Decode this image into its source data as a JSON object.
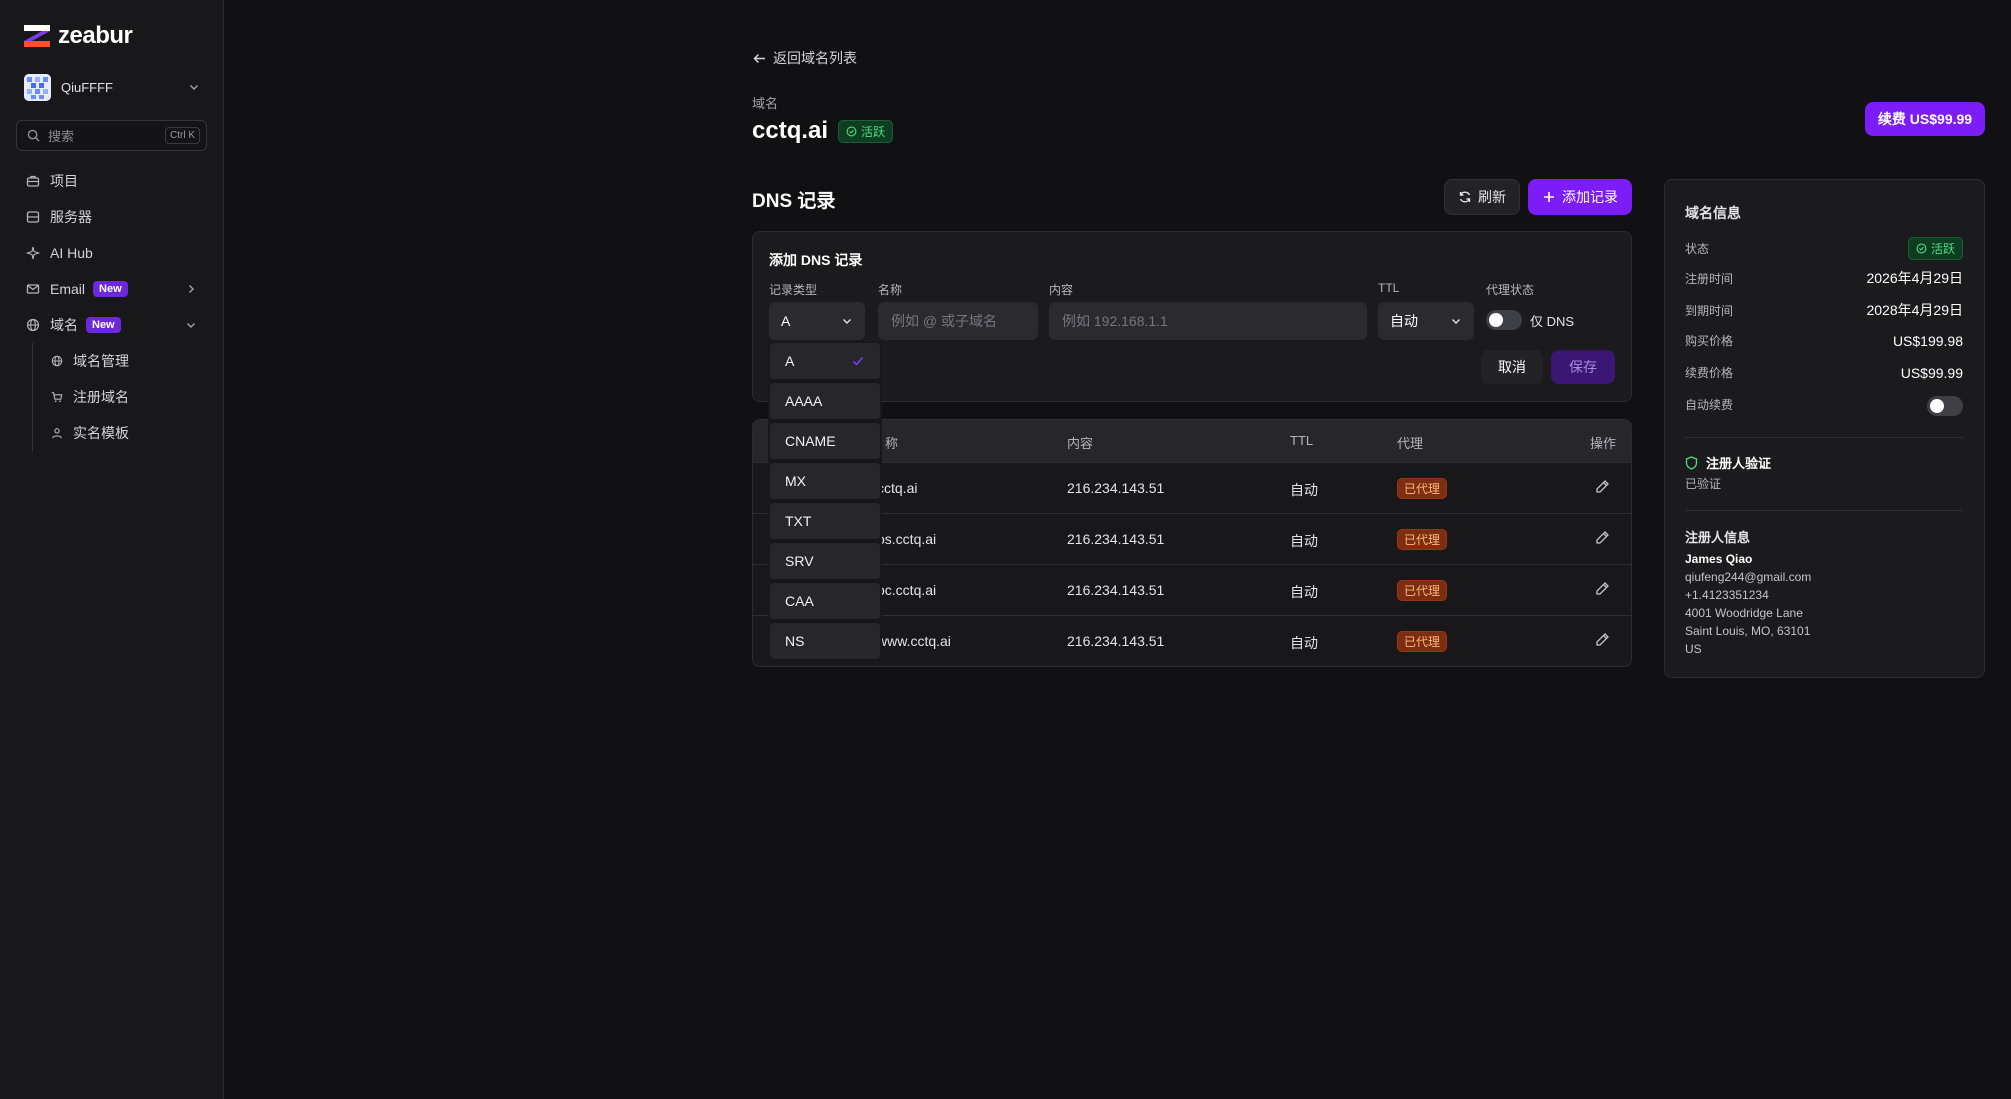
{
  "brand": {
    "name": "zeabur"
  },
  "sidebar": {
    "team": "QiuFFFF",
    "search": {
      "placeholder": "搜索",
      "shortcut": "Ctrl K"
    },
    "items": [
      {
        "label": "项目",
        "icon": "briefcase-icon"
      },
      {
        "label": "服务器",
        "icon": "server-icon"
      },
      {
        "label": "AI Hub",
        "icon": "sparkle-icon"
      },
      {
        "label": "Email",
        "icon": "mail-icon",
        "badge": "New"
      },
      {
        "label": "域名",
        "icon": "globe-icon",
        "badge": "New"
      }
    ],
    "sub_items": [
      {
        "label": "域名管理",
        "icon": "globe-icon"
      },
      {
        "label": "注册域名",
        "icon": "cart-icon"
      },
      {
        "label": "实名模板",
        "icon": "user-icon"
      }
    ]
  },
  "header": {
    "back_label": "返回域名列表",
    "domain_label": "域名",
    "domain_name": "cctq.ai",
    "status": "活跃",
    "renew_label": "续费 US$99.99"
  },
  "dns": {
    "title": "DNS 记录",
    "refresh_label": "刷新",
    "add_label": "添加记录",
    "form": {
      "title": "添加 DNS 记录",
      "type_label": "记录类型",
      "type_value": "A",
      "name_label": "名称",
      "name_placeholder": "例如 @ 或子域名",
      "content_label": "内容",
      "content_placeholder": "例如 192.168.1.1",
      "ttl_label": "TTL",
      "ttl_value": "自动",
      "proxy_label": "代理状态",
      "proxy_value": "仅 DNS",
      "cancel_label": "取消",
      "save_label": "保存"
    },
    "type_options": [
      "A",
      "AAAA",
      "CNAME",
      "MX",
      "TXT",
      "SRV",
      "CAA",
      "NS"
    ],
    "selected_type": "A",
    "table": {
      "headers": [
        "称",
        "内容",
        "TTL",
        "代理",
        "操作"
      ],
      "rows": [
        {
          "name": "cctq.ai",
          "content": "216.234.143.51",
          "ttl": "自动",
          "proxy": "已代理"
        },
        {
          "name": "os.cctq.ai",
          "content": "216.234.143.51",
          "ttl": "自动",
          "proxy": "已代理"
        },
        {
          "name": "oc.cctq.ai",
          "content": "216.234.143.51",
          "ttl": "自动",
          "proxy": "已代理"
        },
        {
          "name": "www.cctq.ai",
          "content": "216.234.143.51",
          "ttl": "自动",
          "proxy": "已代理"
        }
      ]
    }
  },
  "info": {
    "title": "域名信息",
    "status_label": "状态",
    "status_value": "活跃",
    "registered_label": "注册时间",
    "registered_value": "2026年4月29日",
    "expires_label": "到期时间",
    "expires_value": "2028年4月29日",
    "purchase_label": "购买价格",
    "purchase_value": "US$199.98",
    "renew_price_label": "续费价格",
    "renew_price_value": "US$99.99",
    "auto_renew_label": "自动续费",
    "verify_title": "注册人验证",
    "verify_status": "已验证",
    "registrant_title": "注册人信息",
    "registrant": {
      "name": "James Qiao",
      "email": "qiufeng244@gmail.com",
      "phone": "+1.4123351234",
      "address1": "4001 Woodridge Lane",
      "address2": "Saint Louis, MO, 63101",
      "country": "US"
    }
  },
  "colors": {
    "accent": "#7c1cf7",
    "success": "#4ade80",
    "proxy_badge": "#fdba74",
    "background": "#111113"
  }
}
